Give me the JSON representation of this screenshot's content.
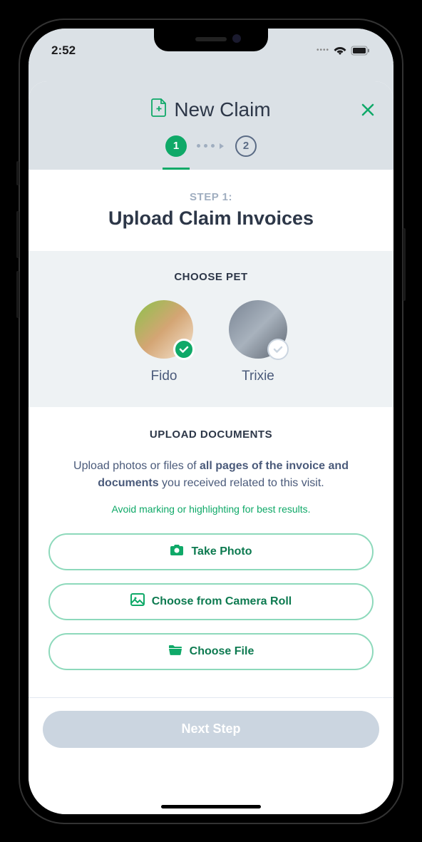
{
  "status": {
    "time": "2:52"
  },
  "header": {
    "title": "New Claim"
  },
  "stepper": {
    "step1": "1",
    "step2": "2"
  },
  "step": {
    "label": "STEP 1:",
    "title": "Upload Claim Invoices"
  },
  "choosePet": {
    "label": "CHOOSE PET",
    "pets": [
      {
        "name": "Fido",
        "selected": true
      },
      {
        "name": "Trixie",
        "selected": false
      }
    ]
  },
  "upload": {
    "label": "UPLOAD DOCUMENTS",
    "descPrefix": "Upload photos or files of ",
    "descBold": "all pages of the invoice and documents",
    "descSuffix": " you received related to this visit.",
    "hint": "Avoid marking or highlighting for best results.",
    "buttons": {
      "takePhoto": "Take Photo",
      "cameraRoll": "Choose from Camera Roll",
      "chooseFile": "Choose File"
    }
  },
  "footer": {
    "nextStep": "Next Step"
  }
}
